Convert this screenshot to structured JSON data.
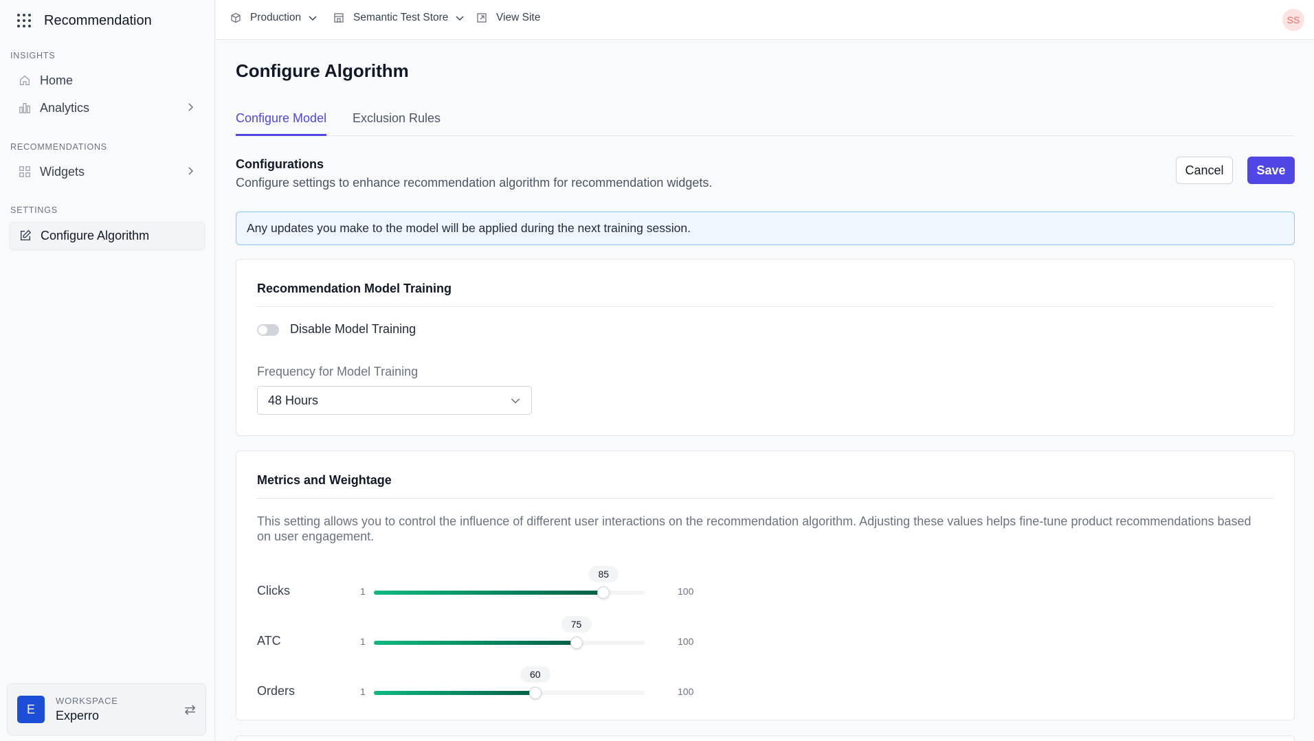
{
  "app": {
    "title": "Recommendation"
  },
  "sidebar": {
    "sections": [
      {
        "label": "INSIGHTS"
      },
      {
        "label": "RECOMMENDATIONS"
      },
      {
        "label": "SETTINGS"
      }
    ],
    "items": [
      {
        "label": "Home",
        "icon": "home-icon"
      },
      {
        "label": "Analytics",
        "icon": "analytics-icon"
      },
      {
        "label": "Widgets",
        "icon": "widgets-icon"
      },
      {
        "label": "Configure Algorithm",
        "icon": "edit-icon",
        "active": true
      }
    ],
    "workspace": {
      "label": "WORKSPACE",
      "name": "Experro",
      "avatar": "E"
    }
  },
  "topbar": {
    "environment": "Production",
    "store": "Semantic Test Store",
    "view_site": "View Site",
    "user_initials": "SS"
  },
  "main": {
    "title": "Configure Algorithm",
    "tabs": [
      {
        "label": "Configure Model",
        "active": true
      },
      {
        "label": "Exclusion Rules",
        "active": false
      }
    ],
    "configurations": {
      "title": "Configurations",
      "description": "Configure settings to enhance recommendation algorithm for recommendation widgets."
    },
    "buttons": {
      "cancel": "Cancel",
      "save": "Save"
    },
    "info_banner": "Any updates you make to the model will be applied during the next training session.",
    "training_card": {
      "title": "Recommendation Model Training",
      "toggle_label": "Disable Model Training",
      "toggle_on": false,
      "frequency_label": "Frequency for Model Training",
      "frequency_value": "48 Hours"
    },
    "metrics_card": {
      "title": "Metrics and Weightage",
      "description": "This setting allows you to control the influence of different user interactions on the recommendation algorithm. Adjusting these values helps fine-tune product recommendations based on user engagement.",
      "sliders": [
        {
          "label": "Clicks",
          "min": "1",
          "max": "100",
          "value": "85"
        },
        {
          "label": "ATC",
          "min": "1",
          "max": "100",
          "value": "75"
        },
        {
          "label": "Orders",
          "min": "1",
          "max": "100",
          "value": "60"
        }
      ]
    }
  },
  "colors": {
    "accent": "#4f46e5",
    "slider_start": "#10b981",
    "slider_end": "#065f46",
    "info_bg": "#eff6ff",
    "info_border": "#93c5fd"
  }
}
